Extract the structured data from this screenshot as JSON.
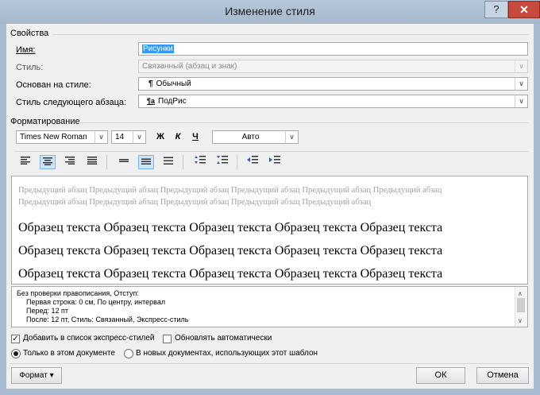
{
  "window": {
    "title": "Изменение стиля",
    "help_glyph": "?",
    "close_glyph": "✕"
  },
  "properties": {
    "group_label": "Свойства",
    "name_label": "Имя:",
    "name_value": "Рисунки",
    "style_label": "Стиль:",
    "style_value": "Связанный (абзац и знак)",
    "based_on_label": "Основан на стиле:",
    "based_on_value": "Обычный",
    "based_on_glyph": "¶",
    "next_label": "Стиль следующего абзаца:",
    "next_value": "ПодРис",
    "next_glyph": "¶a"
  },
  "formatting": {
    "group_label": "Форматирование",
    "font_value": "Times New Roman",
    "size_value": "14",
    "bold": "Ж",
    "italic": "К",
    "underline": "Ч",
    "color_value": "Авто"
  },
  "preview": {
    "previous_paragraph": "Предыдущий абзац Предыдущий абзац Предыдущий абзац Предыдущий абзац Предыдущий абзац Предыдущий абзац Предыдущий абзац Предыдущий абзац Предыдущий абзац Предыдущий абзац Предыдущий абзац",
    "sample_line_1": "Образец текста Образец текста Образец текста Образец текста Образец текста",
    "sample_line_2": "Образец текста Образец текста Образец текста Образец текста Образец текста",
    "sample_line_3": "Образец текста Образец текста Образец текста Образец текста Образец текста"
  },
  "description": {
    "line1": "Без проверки правописания, Отступ:",
    "line2": "Первая строка:  0 см, По центру, интервал",
    "line3": "Перед:  12 пт",
    "line4": "После:  12 пт, Стиль: Связанный, Экспресс-стиль"
  },
  "options": {
    "add_quick_styles": "Добавить в список экспресс-стилей",
    "auto_update": "Обновлять автоматически",
    "this_document": "Только в этом документе",
    "new_documents": "В новых документах, использующих этот шаблон"
  },
  "buttons": {
    "format": "Формат ▾",
    "ok": "ОК",
    "cancel": "Отмена"
  }
}
